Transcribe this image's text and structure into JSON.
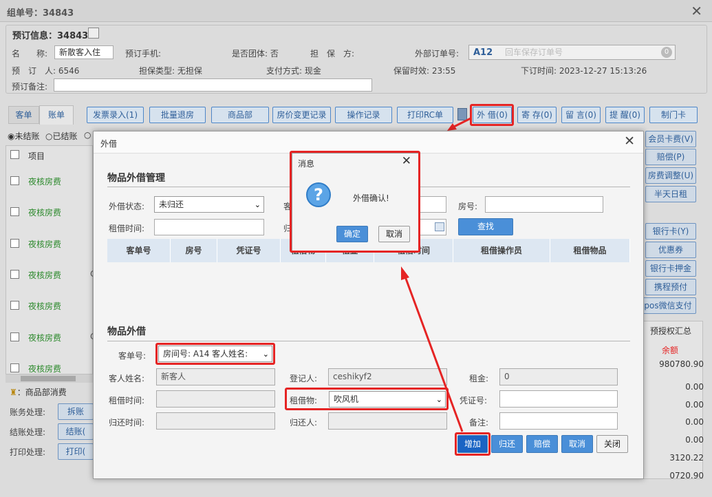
{
  "window": {
    "title": "组单号：34843"
  },
  "booking": {
    "header": "预订信息：34843",
    "name_label": "名　　称:",
    "name_value": "新散客入住",
    "phone_label": "预订手机:",
    "group_label": "是否团体: 否",
    "guarantor_label": "担　保　方:",
    "ext_order_label": "外部订单号:",
    "ext_order_room": "A12",
    "ext_order_placeholder": "回车保存订单号",
    "ext_order_count": "0",
    "booker_label": "预　订　人: 6546",
    "guarantee_type": "担保类型: 无担保",
    "pay_method": "支付方式: 现金",
    "hold_time": "保留时效: 23:55",
    "order_time": "下订时间: 2023-12-27 15:13:26",
    "remark_label": "预订备注:"
  },
  "tabs": [
    "客单",
    "账单"
  ],
  "toolbar": [
    "发票录入(1)",
    "批量退房",
    "商品部",
    "房价变更记录",
    "操作记录",
    "打印RC单",
    "外 借(0)",
    "寄 存(0)",
    "留 言(0)",
    "提 醒(0)",
    "制门卡"
  ],
  "filters": {
    "unsettled": "未结账",
    "settled": "已结账"
  },
  "table": {
    "col_item": "项目",
    "rows": [
      "夜核房费",
      "夜核房费",
      "夜核房费",
      "夜核房费",
      "夜核房费",
      "夜核房费",
      "夜核房费"
    ],
    "partial_cells": [
      "C",
      "C"
    ]
  },
  "right_buttons": [
    "会员卡费(V)",
    "赔偿(P)",
    "房费调整(U)",
    "半天日租",
    "银行卡(Y)",
    "优惠券",
    "银行卡押金",
    "携程预付",
    "pos微信支付"
  ],
  "right_table": {
    "header": "预授权汇总",
    "col": "余额",
    "values": [
      "980780.90",
      "0.00",
      "0.00",
      "0.00",
      "0.00",
      "3120.22",
      "0720.90"
    ]
  },
  "bottom_left": {
    "shop": "：商品部消费",
    "account_label": "账务处理:",
    "account_btn": "拆账",
    "checkout_label": "结账处理:",
    "checkout_btn": "结账(",
    "print_label": "打印处理:",
    "print_btn": "打印("
  },
  "dialog": {
    "title": "外借",
    "mgmt_title": "物品外借管理",
    "status_label": "外借状态:",
    "status_value": "未归还",
    "guest_label": "客",
    "room_label": "房号:",
    "rent_time_label": "租借时间:",
    "return_label": "归",
    "search_btn": "查找",
    "columns": [
      "客单号",
      "房号",
      "凭证号",
      "租借物",
      "租金",
      "租借时间",
      "租借操作员",
      "租借物品"
    ],
    "lend_title": "物品外借",
    "guest_no_label": "客单号:",
    "guest_no_value": "房间号: A14 客人姓名:",
    "guest_name_label": "客人姓名:",
    "guest_name_value": "新客人",
    "registrar_label": "登记人:",
    "registrar_value": "ceshikyf2",
    "rent_label": "租金:",
    "rent_value": "0",
    "rent_time2_label": "租借时间:",
    "item_label": "租借物:",
    "item_value": "吹风机",
    "voucher_label": "凭证号:",
    "return_time_label": "归还时间:",
    "returner_label": "归还人:",
    "remark_label": "备注:",
    "buttons": [
      "增加",
      "归还",
      "赔偿",
      "取消",
      "关闭"
    ]
  },
  "msgbox": {
    "title": "消息",
    "text": "外借确认!",
    "ok": "确定",
    "cancel": "取消"
  },
  "colors": {
    "accent": "#4a8fd8",
    "highlight": "#e52424",
    "green_text": "#2d8a2d",
    "red_text": "#e52424"
  }
}
